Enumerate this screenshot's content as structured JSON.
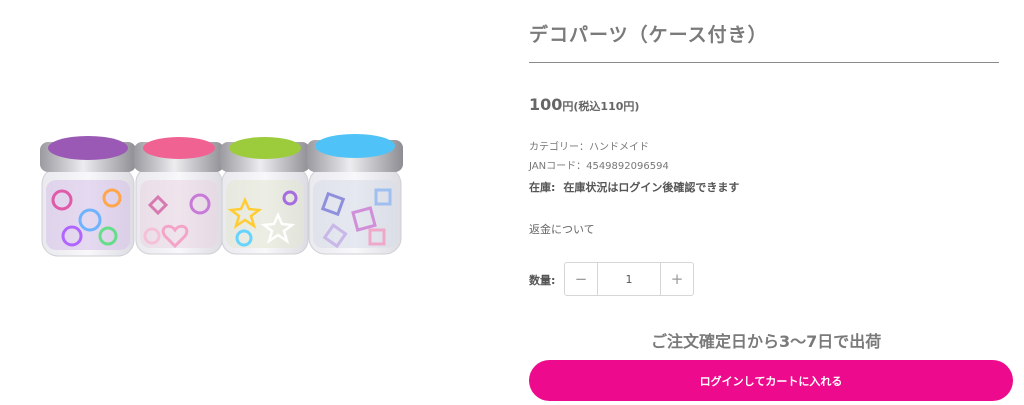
{
  "product": {
    "title": "デコパーツ（ケース付き）",
    "price": "100",
    "price_suffix": "円(税込110円)",
    "category": "カテゴリー：ハンドメイド",
    "jan": "JANコード：4549892096594",
    "stock_label": "在庫:",
    "stock_text": "在庫状況はログイン後確認できます",
    "refund_link": "返金について",
    "quantity_label": "数量:",
    "quantity_value": "1",
    "minus_symbol": "−",
    "plus_symbol": "+",
    "shipping_note": "ご注文確定日から3〜7日で出荷",
    "cart_button": "ログインしてカートに入れる"
  },
  "image": {
    "jar_lid_colors": [
      "#9b59b6",
      "#f06292",
      "#9ccc3c",
      "#4fc3f7"
    ],
    "accent_color": "#ee0a8c"
  }
}
